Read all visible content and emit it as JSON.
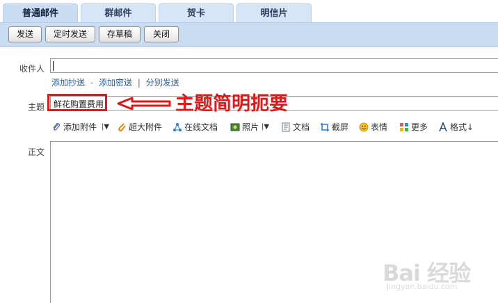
{
  "tabs": [
    {
      "label": "普通邮件",
      "active": true
    },
    {
      "label": "群邮件",
      "active": false
    },
    {
      "label": "贺卡",
      "active": false
    },
    {
      "label": "明信片",
      "active": false
    }
  ],
  "toolbar": {
    "send_label": "发送",
    "scheduled_send_label": "定时发送",
    "save_draft_label": "存草稿",
    "close_label": "关闭"
  },
  "compose": {
    "to_label": "收件人",
    "to_value": "",
    "cc_link": "添加抄送",
    "link_dash": "-",
    "bcc_link": "添加密送",
    "link_bar": "|",
    "split_send_link": "分别发送",
    "subject_label": "主题",
    "subject_value": "鲜花购置费用",
    "body_label": "正文",
    "body_value": ""
  },
  "attachments_bar": [
    {
      "label": "添加附件",
      "icon": "paperclip-icon",
      "dropdown": true
    },
    {
      "label": "超大附件",
      "icon": "large-attachment-icon",
      "dropdown": false
    },
    {
      "label": "在线文档",
      "icon": "online-doc-icon",
      "dropdown": false
    },
    {
      "label": "照片",
      "icon": "photo-icon",
      "dropdown": true
    },
    {
      "label": "文档",
      "icon": "document-icon",
      "dropdown": false
    },
    {
      "label": "截屏",
      "icon": "screenshot-icon",
      "dropdown": false
    },
    {
      "label": "表情",
      "icon": "emoji-icon",
      "dropdown": false
    },
    {
      "label": "更多",
      "icon": "more-icon",
      "dropdown": false
    },
    {
      "label": "格式",
      "icon": "format-icon",
      "dropdown": false
    }
  ],
  "annotation": {
    "text": "主题简明扼要",
    "color": "#e01818"
  },
  "watermark": {
    "main": "Bai 经验",
    "sub": "jingyan.baidu.com"
  }
}
